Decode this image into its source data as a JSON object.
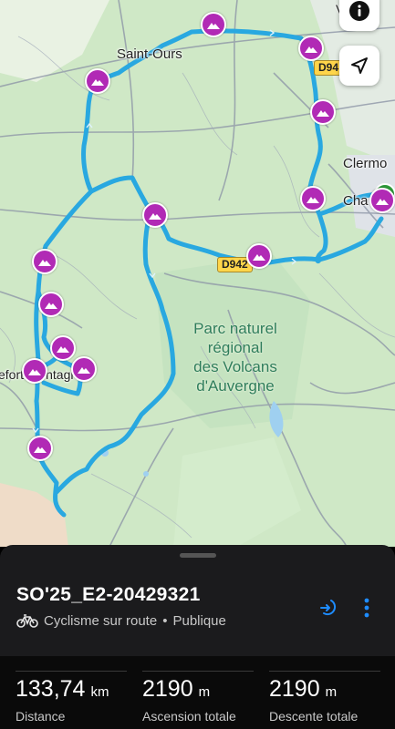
{
  "map": {
    "labels": {
      "saint_ours": "Saint-Ours",
      "clermont": "Clermo",
      "cha": "Cha",
      "montagne": "efort-Montagne",
      "vi": "V"
    },
    "park_label": [
      "Parc naturel",
      "régional",
      "des Volcans",
      "d'Auvergne"
    ],
    "road_badges": [
      "D94",
      "D942"
    ],
    "buttons": [
      "info-icon",
      "navigation-arrow-icon"
    ],
    "route_color": "#29a8e0",
    "pin_color": "#b12ab5"
  },
  "activity": {
    "title": "SO'25_E2-20429321",
    "type": "Cyclisme sur route",
    "separator": "•",
    "visibility": "Publique",
    "type_icon": "bicycle-icon",
    "actions": [
      "send-to-device-icon",
      "more-vertical-icon"
    ],
    "accent_color": "#1e8cff"
  },
  "stats": [
    {
      "value": "133,74",
      "unit": "km",
      "label": "Distance"
    },
    {
      "value": "2190",
      "unit": "m",
      "label": "Ascension totale"
    },
    {
      "value": "2190",
      "unit": "m",
      "label": "Descente totale"
    }
  ]
}
